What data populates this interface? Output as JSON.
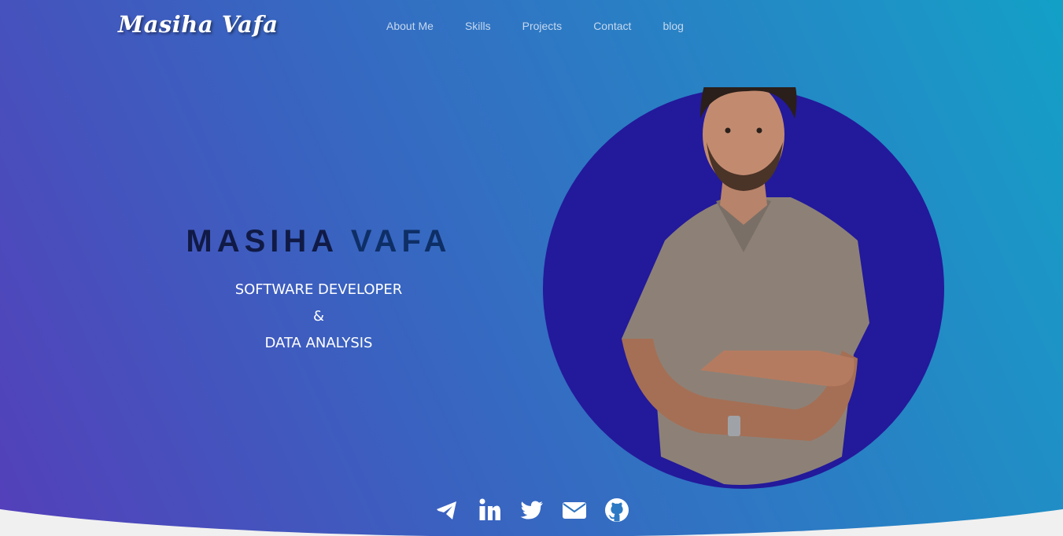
{
  "brand": {
    "title": "Masiha Vafa"
  },
  "nav": {
    "items": [
      {
        "label": "About Me"
      },
      {
        "label": "Skills"
      },
      {
        "label": "Projects"
      },
      {
        "label": "Contact"
      },
      {
        "label": "blog"
      }
    ]
  },
  "hero": {
    "first_name": "MASIHA",
    "last_name": "VAFA",
    "role_line1": "SOFTWARE DEVELOPER",
    "role_line2": "&",
    "role_line3": "DATA ANALYSIS"
  },
  "portrait": {
    "description_icon": "profile-photo"
  },
  "socials": [
    {
      "icon": "telegram-icon"
    },
    {
      "icon": "linkedin-icon"
    },
    {
      "icon": "twitter-icon"
    },
    {
      "icon": "email-icon"
    },
    {
      "icon": "github-icon"
    }
  ],
  "colors": {
    "gradient_start": "#5a37b8",
    "gradient_end": "#00b2c9",
    "circle": "#23199b",
    "page_bg": "#f0f0f0"
  }
}
